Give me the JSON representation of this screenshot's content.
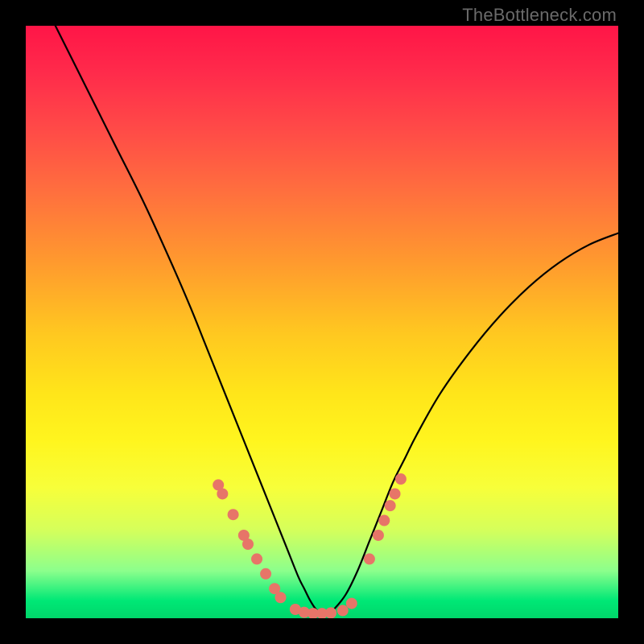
{
  "watermark": "TheBottleneck.com",
  "colors": {
    "frame": "#000000",
    "curve": "#000000",
    "marker_fill": "#e77568",
    "marker_stroke": "#c95a50"
  },
  "chart_data": {
    "type": "line",
    "title": "",
    "xlabel": "",
    "ylabel": "",
    "xlim": [
      0,
      100
    ],
    "ylim": [
      0,
      100
    ],
    "grid": false,
    "legend": false,
    "series": [
      {
        "name": "curve",
        "x": [
          5,
          10,
          15,
          20,
          25,
          28,
          30,
          32,
          34,
          36,
          38,
          40,
          42,
          44,
          46,
          47,
          48,
          49,
          50,
          51,
          52,
          54,
          56,
          58,
          60,
          62,
          64,
          66,
          70,
          75,
          80,
          85,
          90,
          95,
          100
        ],
        "y": [
          100,
          90,
          80,
          70,
          59,
          52,
          47,
          42,
          37,
          32,
          27,
          22,
          17,
          12,
          7,
          5,
          3,
          1.5,
          0.8,
          0.8,
          1.5,
          4,
          8,
          13,
          18,
          23,
          27,
          31,
          38,
          45,
          51,
          56,
          60,
          63,
          65
        ]
      }
    ],
    "annotations": {
      "markers": [
        {
          "x": 32.5,
          "y": 22.5
        },
        {
          "x": 33.2,
          "y": 21.0
        },
        {
          "x": 35.0,
          "y": 17.5
        },
        {
          "x": 36.8,
          "y": 14.0
        },
        {
          "x": 37.5,
          "y": 12.5
        },
        {
          "x": 39.0,
          "y": 10.0
        },
        {
          "x": 40.5,
          "y": 7.5
        },
        {
          "x": 42.0,
          "y": 5.0
        },
        {
          "x": 43.0,
          "y": 3.5
        },
        {
          "x": 45.5,
          "y": 1.5
        },
        {
          "x": 47.0,
          "y": 1.0
        },
        {
          "x": 48.5,
          "y": 0.8
        },
        {
          "x": 50.0,
          "y": 0.8
        },
        {
          "x": 51.5,
          "y": 0.9
        },
        {
          "x": 53.5,
          "y": 1.3
        },
        {
          "x": 55.0,
          "y": 2.5
        },
        {
          "x": 58.0,
          "y": 10.0
        },
        {
          "x": 59.5,
          "y": 14.0
        },
        {
          "x": 60.5,
          "y": 16.5
        },
        {
          "x": 61.5,
          "y": 19.0
        },
        {
          "x": 62.3,
          "y": 21.0
        },
        {
          "x": 63.3,
          "y": 23.5
        }
      ]
    }
  }
}
